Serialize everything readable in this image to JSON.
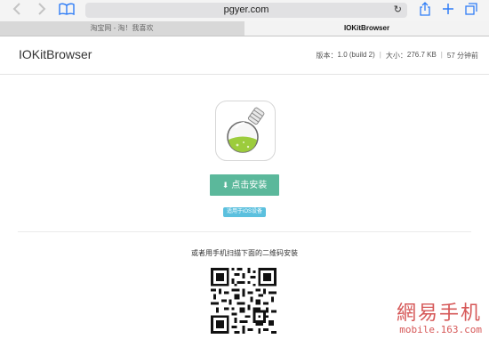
{
  "browser": {
    "url": "pgyer.com",
    "tabs": [
      {
        "label": "淘宝网 - 淘！我喜欢",
        "active": false
      },
      {
        "label": "IOKitBrowser",
        "active": true
      }
    ],
    "icons": {
      "back": "chevron-left-icon",
      "forward": "chevron-right-icon",
      "bookmarks": "open-book-icon",
      "reload": "reload-icon",
      "share": "share-icon",
      "new_tab": "plus-icon",
      "tabs": "tabs-icon"
    }
  },
  "header": {
    "app_name": "IOKitBrowser",
    "version_label": "版本：",
    "version_value": "1.0 (build 2)",
    "size_label": "大小：",
    "size_value": "276.7 KB",
    "time_value": "57 分钟前"
  },
  "main": {
    "install_label": "点击安装",
    "ios_badge": "适用于iOS设备",
    "scan_text": "或者用手机扫描下面的二维码安装"
  },
  "watermark": {
    "cn": "網易手机",
    "url": "mobile.163.com"
  },
  "colors": {
    "install_button": "#5bb89b",
    "ios_badge": "#5bc0de",
    "link_blue": "#2f7df6",
    "watermark": "#d24646"
  }
}
